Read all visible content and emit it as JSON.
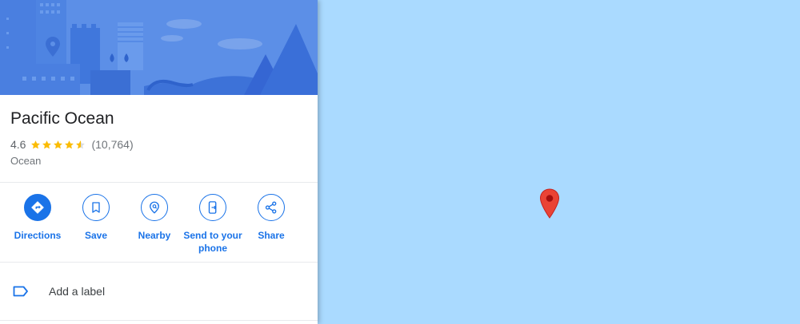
{
  "place": {
    "title": "Pacific Ocean",
    "rating": "4.6",
    "stars": 4.6,
    "review_count": "(10,764)",
    "category": "Ocean"
  },
  "actions": [
    {
      "label": "Directions",
      "icon": "directions-icon"
    },
    {
      "label": "Save",
      "icon": "bookmark-icon"
    },
    {
      "label": "Nearby",
      "icon": "nearby-icon"
    },
    {
      "label": "Send to your phone",
      "icon": "send-to-phone-icon"
    },
    {
      "label": "Share",
      "icon": "share-icon"
    }
  ],
  "label_row": {
    "text": "Add a label",
    "icon": "label-icon"
  },
  "colors": {
    "accent": "#1a73e8",
    "map_water": "#aadaff",
    "pin": "#ea4335",
    "star": "#fbbc04"
  }
}
